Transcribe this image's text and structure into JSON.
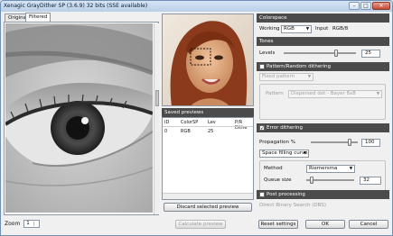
{
  "window": {
    "title": "Xenagic GrayDither SP (3.6.9) 32 bits (SSE available)"
  },
  "tabs": [
    {
      "label": "Original"
    },
    {
      "label": "Filtered"
    }
  ],
  "zoom": {
    "label": "Zoom",
    "value": "1"
  },
  "saved_previews": {
    "title": "Saved previews",
    "columns": [
      "ID",
      "ColorSP",
      "Lev",
      "P/R Dithe"
    ],
    "rows": [
      {
        "id": "0",
        "colorsp": "RGB",
        "lev": "25",
        "pr": ""
      }
    ]
  },
  "buttons": {
    "discard": "Discard selected preview",
    "calculate": "Calculate preview",
    "reset": "Reset settings",
    "ok": "OK",
    "cancel": "Cancel"
  },
  "colorspace": {
    "title": "Colorspace",
    "working_label": "Working",
    "working_value": "RGB",
    "input_label": "Input",
    "input_value": "RGB/8"
  },
  "tones": {
    "title": "Tones",
    "levels_label": "Levels",
    "levels_value": "25",
    "levels_fraction": 0.72
  },
  "pattern": {
    "title": "Pattern/Random dithering",
    "mode": "Fixed pattern",
    "pattern_label": "Pattern",
    "pattern_value": "Dispersed dot - Bayer 8x8"
  },
  "error": {
    "title": "Error dithering",
    "propagation_label": "Propagation %",
    "propagation_value": "100",
    "propagation_fraction": 0.82,
    "curve": "Space filling curve",
    "method_label": "Method",
    "method_value": "Riemersma",
    "queue_label": "Queue size",
    "queue_value": "32",
    "queue_fraction": 0.12
  },
  "post": {
    "title": "Post processing",
    "dbs_label": "Direct Binary Search (DBS)"
  },
  "colors": {
    "header_bg": "#4b4b4b",
    "title_bg": "#c8d9ec"
  }
}
